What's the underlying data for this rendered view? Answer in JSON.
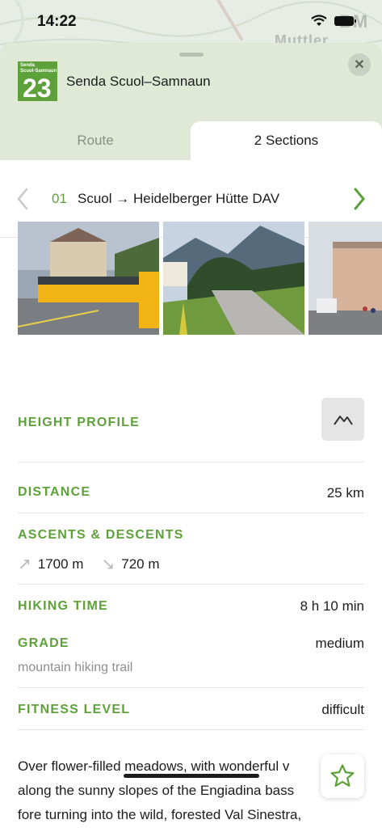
{
  "status_bar": {
    "time": "14:22"
  },
  "map": {
    "labels": [
      "BM",
      "Muttler"
    ]
  },
  "header": {
    "logo_small_text": "Senda\nScuol-Samnaun",
    "logo_number": "23",
    "title": "Senda Scuol–Samnaun",
    "close_label": "✕"
  },
  "tabs": [
    {
      "label": "Route",
      "active": false
    },
    {
      "label": "2 Sections",
      "active": true
    }
  ],
  "section": {
    "number": "01",
    "name": "Scuol → Heidelberger Hütte DAV"
  },
  "info": {
    "height_profile": {
      "label": "HEIGHT PROFILE"
    },
    "distance": {
      "label": "DISTANCE",
      "value": "25 km"
    },
    "ascents": {
      "label": "ASCENTS & DESCENTS",
      "ascent": "1700 m",
      "descent": "720 m"
    },
    "hiking_time": {
      "label": "HIKING TIME",
      "value": "8 h 10 min"
    },
    "grade": {
      "label": "GRADE",
      "value": "medium",
      "sub": "mountain hiking trail"
    },
    "fitness": {
      "label": "FITNESS LEVEL",
      "value": "difficult"
    }
  },
  "description": "Over flower-filled meadows, with wonderful v... along the sunny slopes of the Engiadina bass... fore turning into the wild, forested Val Sinestra,",
  "description_lines": [
    "Over flower-filled meadows, with wonderful v",
    "along the sunny slopes of the Engiadina bass",
    "fore turning into the wild, forested Val Sinestra,"
  ],
  "colors": {
    "accent": "#5ea13a",
    "header_bg": "#dfe9d6"
  }
}
